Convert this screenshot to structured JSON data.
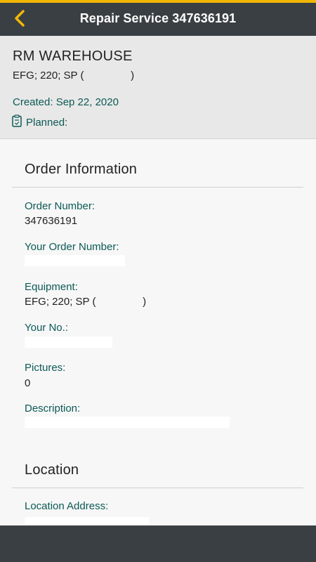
{
  "header": {
    "title": "Repair Service 347636191",
    "back_icon": "chevron-left-icon",
    "accent_color": "#f2b705",
    "bar_color": "#3a3f43"
  },
  "summary": {
    "site": "RM WAREHOUSE",
    "equipment": "EFG; 220; SP (                )",
    "created": "Created: Sep 22, 2020",
    "status_icon": "clipboard-icon",
    "status": "Planned:"
  },
  "order_info": {
    "title": "Order Information",
    "fields": [
      {
        "label": "Order Number:",
        "value": "347636191"
      },
      {
        "label": "Your Order Number:",
        "value": ""
      },
      {
        "label": "Equipment:",
        "value": "EFG; 220; SP (                )"
      },
      {
        "label": "Your No.:",
        "value": ""
      },
      {
        "label": "Pictures:",
        "value": "0"
      },
      {
        "label": "Description:",
        "value": ""
      }
    ]
  },
  "location": {
    "title": "Location",
    "fields": [
      {
        "label": "Location Address:",
        "value": ""
      }
    ]
  }
}
